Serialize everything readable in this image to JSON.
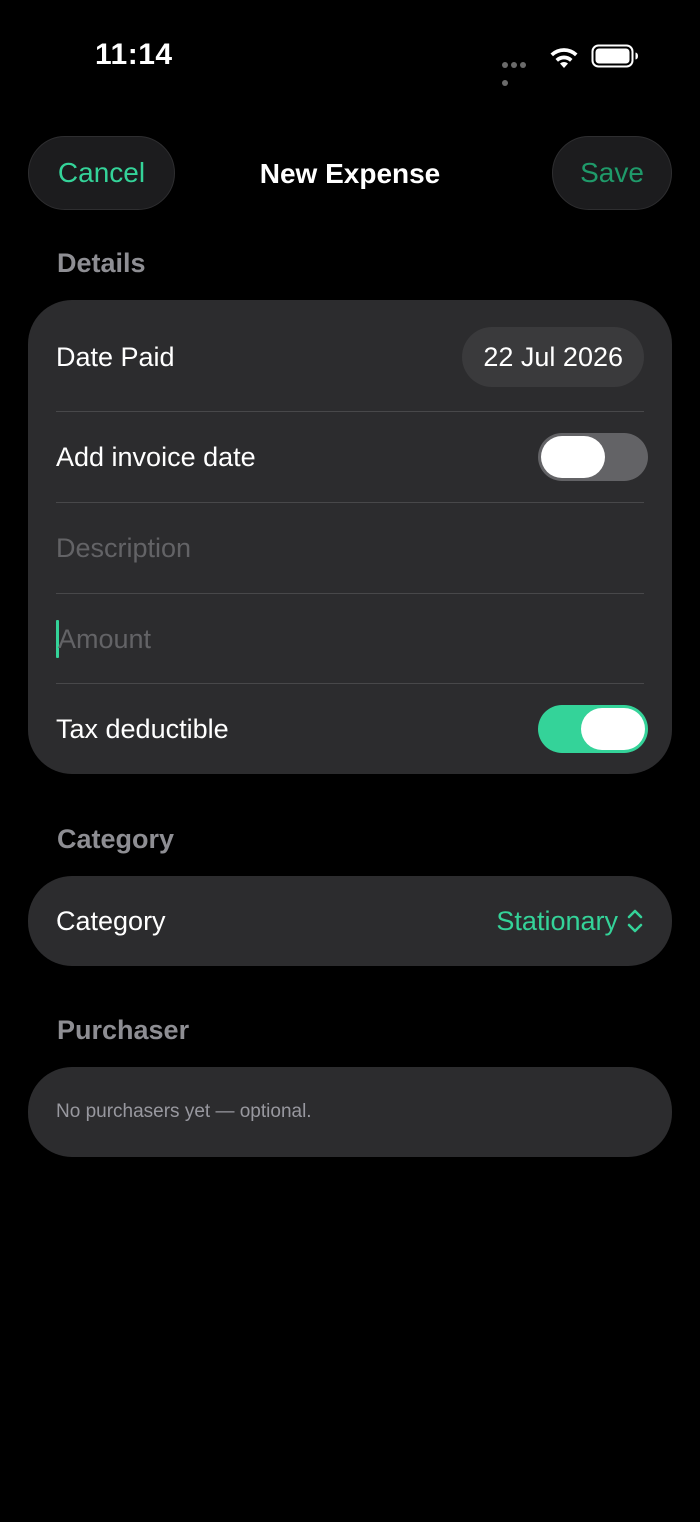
{
  "status_bar": {
    "time": "11:14"
  },
  "nav": {
    "cancel_label": "Cancel",
    "title": "New Expense",
    "save_label": "Save"
  },
  "details": {
    "header": "Details",
    "date_paid_label": "Date Paid",
    "date_paid_value": "22 Jul 2026",
    "invoice_date_label": "Add invoice date",
    "invoice_date_enabled": false,
    "description_placeholder": "Description",
    "description_value": "",
    "amount_placeholder": "Amount",
    "amount_value": "",
    "tax_deductible_label": "Tax deductible",
    "tax_deductible_enabled": true
  },
  "category": {
    "header": "Category",
    "label": "Category",
    "selected": "Stationary"
  },
  "purchaser": {
    "header": "Purchaser",
    "empty_text": "No purchasers yet — optional."
  },
  "colors": {
    "accent": "#34d399",
    "save_text": "#1f9a6a",
    "card": "#2c2c2e",
    "background": "#000000"
  },
  "icons": {
    "wifi": "wifi-icon",
    "battery": "battery-icon",
    "chevron": "chevron-up-down-icon"
  }
}
